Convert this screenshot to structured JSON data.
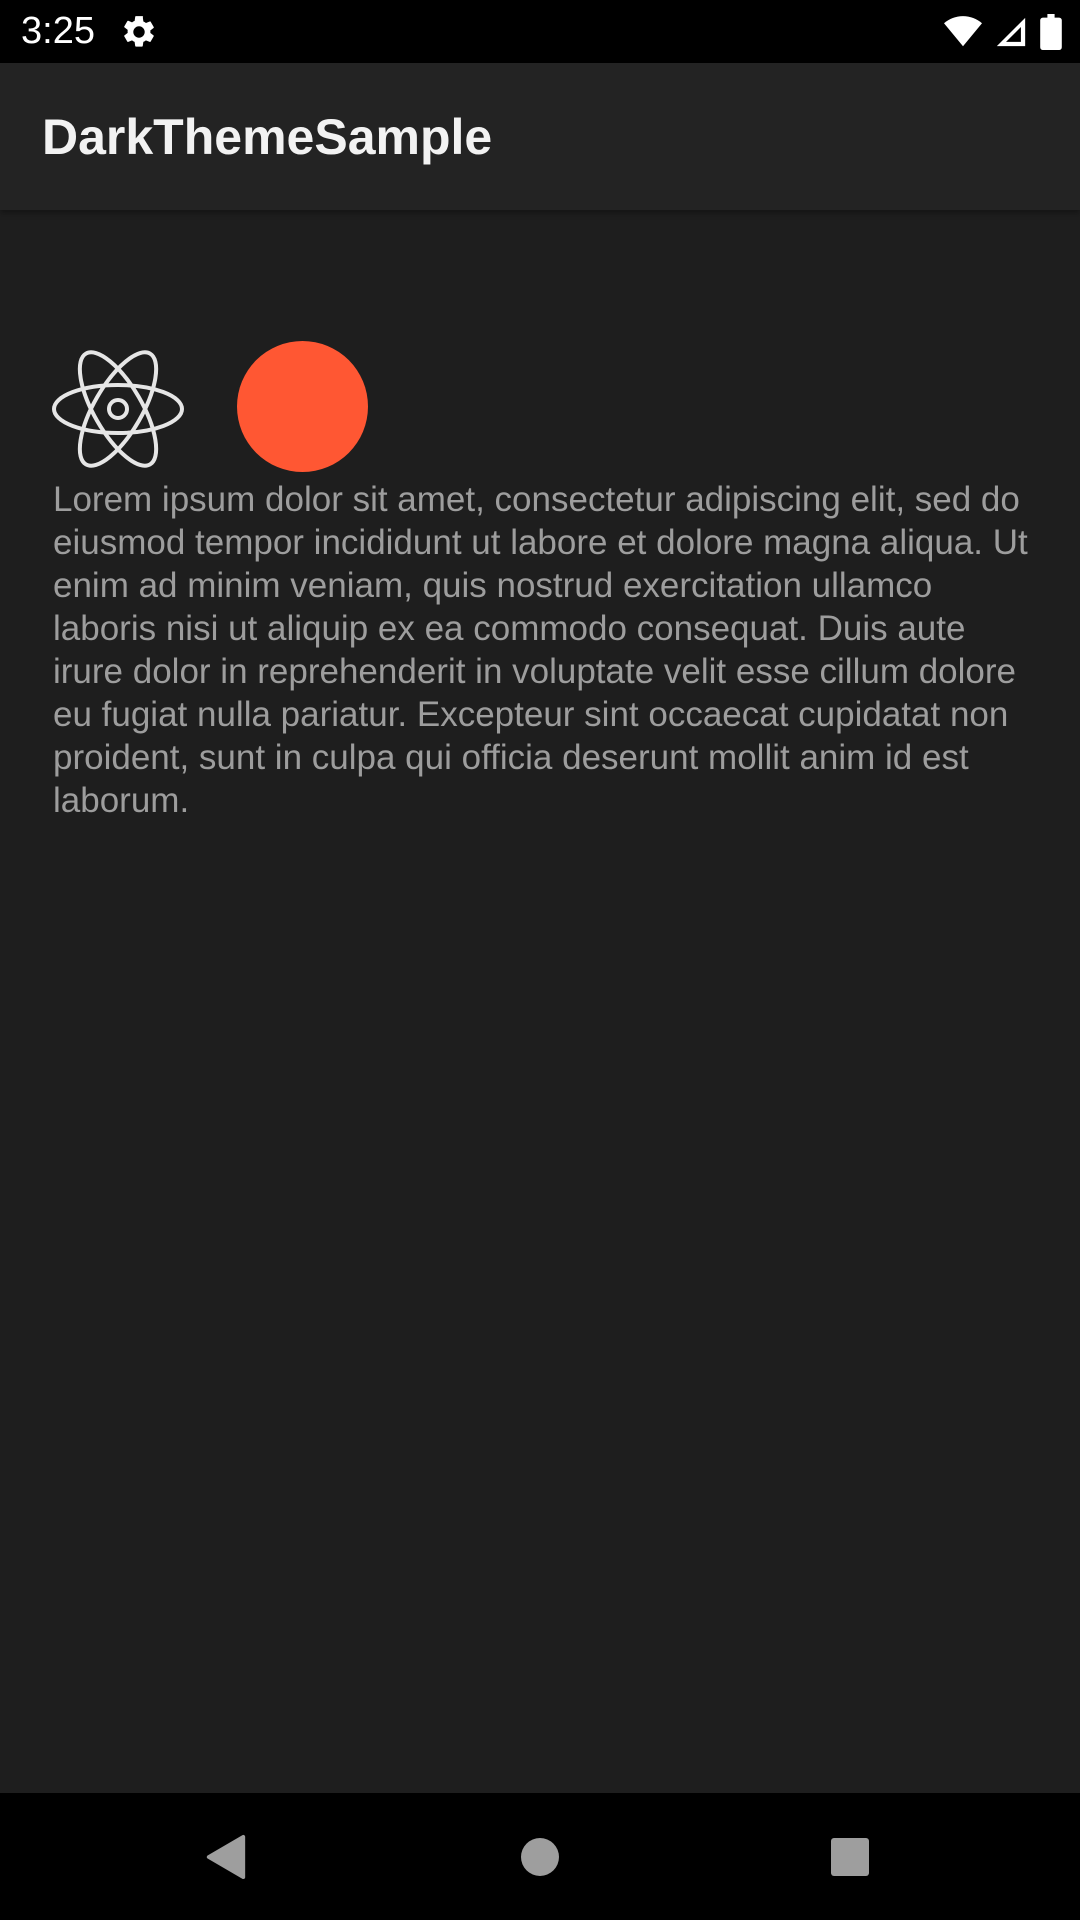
{
  "status_bar": {
    "time": "3:25",
    "icons": [
      "settings-icon",
      "wifi-icon",
      "cell-signal-icon",
      "battery-icon"
    ]
  },
  "app_bar": {
    "title": "DarkThemeSample"
  },
  "content": {
    "icons": [
      "atom-icon",
      "orange-circle"
    ],
    "accent_color": "#ff5733",
    "body_text": "Lorem ipsum dolor sit amet, consectetur adipiscing elit, sed do eiusmod tempor incididunt ut labore et dolore magna aliqua. Ut enim ad minim veniam, quis nostrud exercitation ullamco laboris nisi ut aliquip ex ea commodo consequat. Duis aute irure dolor in reprehenderit in voluptate velit esse cillum dolore eu fugiat nulla pariatur. Excepteur sint occaecat cupidatat non proident, sunt in culpa qui officia deserunt mollit anim id est laborum."
  },
  "nav_bar": {
    "buttons": [
      "back-icon",
      "home-icon",
      "recents-icon"
    ]
  },
  "colors": {
    "background": "#1e1e1e",
    "app_bar": "#232323",
    "status_bar": "#000000",
    "body_text": "#9d9d9d",
    "title_text": "#f2f2f2"
  }
}
